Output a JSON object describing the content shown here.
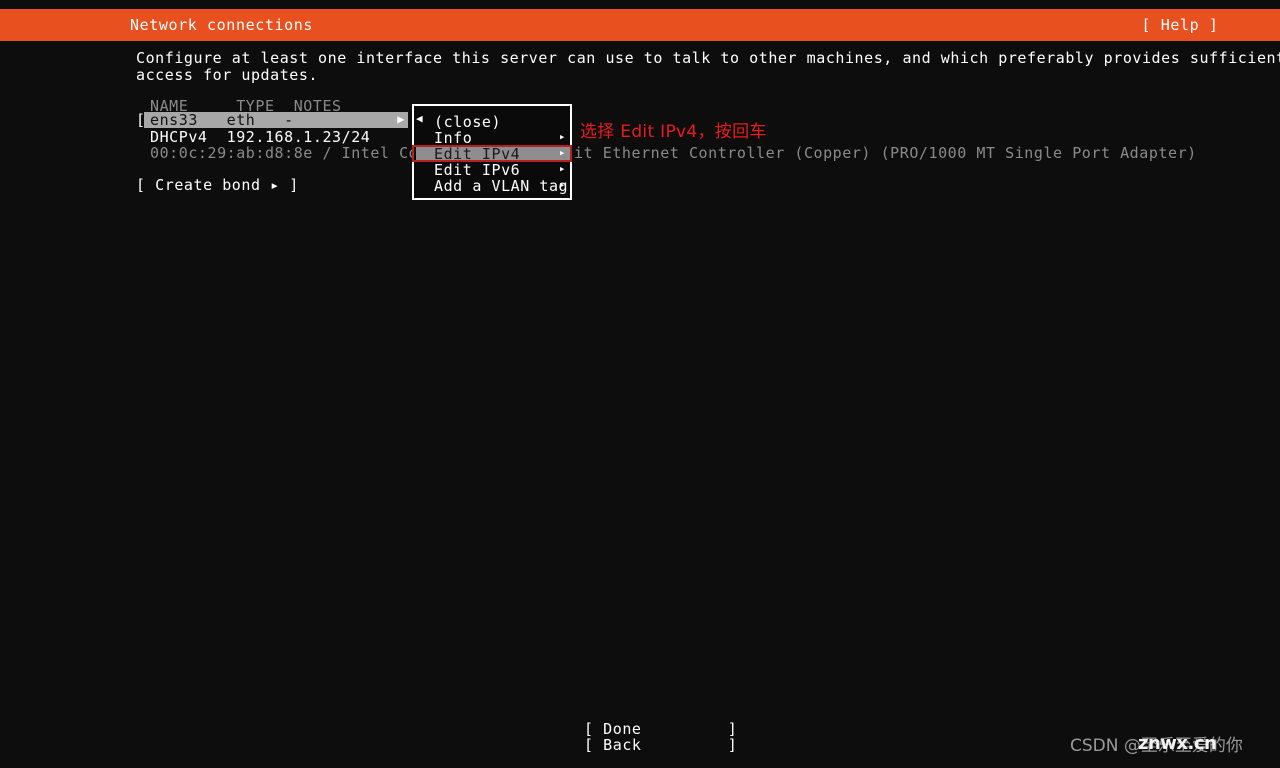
{
  "header": {
    "title": "Network connections",
    "help_label": "[ Help ]",
    "accent_color": "#e8511f"
  },
  "main": {
    "description_line1": "Configure at least one interface this server can use to talk to other machines, and which preferably provides sufficient",
    "description_line2": "access for updates.",
    "table": {
      "headers": "NAME     TYPE  NOTES",
      "selected_row": {
        "bracket_left": "[",
        "cells": "ens33   eth   -",
        "expand_icon": "▶"
      },
      "detail_ip": "DHCPv4  192.168.1.23/24",
      "detail_mac": "00:0c:29:ab:d8:8e / Intel Corpor",
      "detail_mac_tail": "it Ethernet Controller (Copper) (PRO/1000 MT Single Port Adapter)"
    },
    "create_bond_label": "[ Create bond ▸ ]"
  },
  "menu": {
    "back_arrow": "◀",
    "items": [
      {
        "label": "(close)",
        "has_submenu": false,
        "selected": false
      },
      {
        "label": "Info",
        "has_submenu": true,
        "selected": false
      },
      {
        "label": "Edit IPv4",
        "has_submenu": true,
        "selected": true
      },
      {
        "label": "Edit IPv6",
        "has_submenu": true,
        "selected": false
      },
      {
        "label": "Add a VLAN tag",
        "has_submenu": true,
        "selected": false
      }
    ],
    "submenu_icon": "▸",
    "highlight_box_color": "#b81f1f"
  },
  "annotation": {
    "text": "选择 Edit IPv4，按回车",
    "color": "#e81c1c"
  },
  "footer": {
    "done_label": "[ Done         ]",
    "back_label": "[ Back         ]"
  },
  "watermark": {
    "csdn_text": "CSDN @至乐至爱的你",
    "site_text": "znwx.cn"
  }
}
